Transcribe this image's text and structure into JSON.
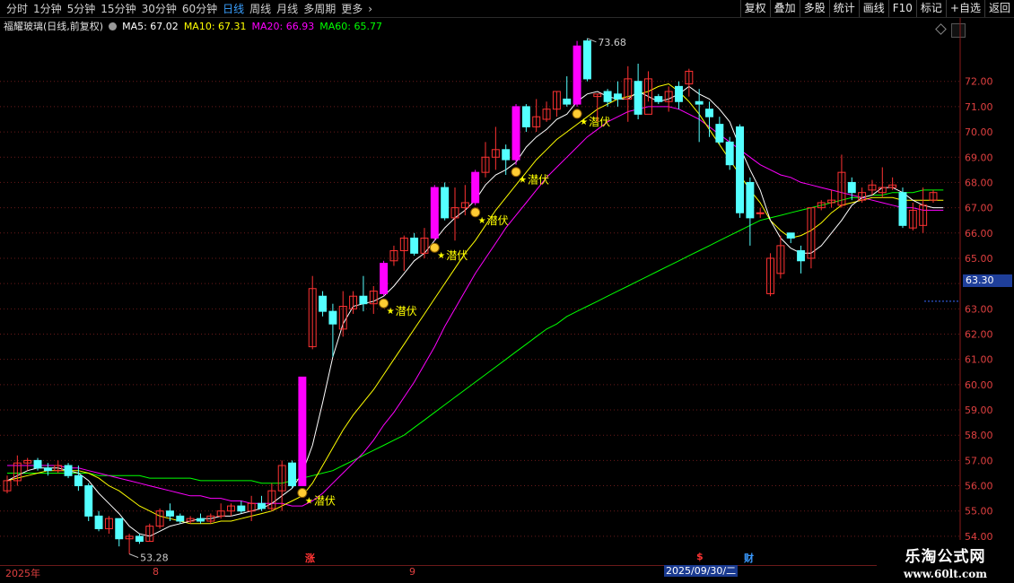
{
  "toolbar": {
    "periods": [
      "分时",
      "1分钟",
      "5分钟",
      "15分钟",
      "30分钟",
      "60分钟",
      "日线",
      "周线",
      "月线",
      "多周期",
      "更多"
    ],
    "active_period": "日线",
    "right_buttons": [
      "复权",
      "叠加",
      "多股",
      "统计",
      "画线",
      "F10",
      "标记",
      "+自选",
      "返回"
    ]
  },
  "info": {
    "title": "福耀玻璃(日线,前复权)",
    "ma5": "MA5: 67.02",
    "ma10": "MA10: 67.31",
    "ma20": "MA20: 66.93",
    "ma60": "MA60: 65.77"
  },
  "colors": {
    "up": "#ff3232",
    "down": "#54ffff",
    "ma5": "#ffffff",
    "ma10": "#ffff00",
    "ma20": "#ff00ff",
    "ma60": "#00ff00",
    "signal_candle": "#ff00ff",
    "signal_text": "#ffff00",
    "grid": "#6a1a1a",
    "axis_text": "#e04040"
  },
  "y_axis": {
    "ticks": [
      "72.00",
      "71.00",
      "70.00",
      "69.00",
      "68.00",
      "67.00",
      "66.00",
      "65.00",
      "64.00",
      "63.00",
      "62.00",
      "61.00",
      "60.00",
      "59.00",
      "58.00",
      "57.00",
      "56.00",
      "55.00",
      "54.00"
    ],
    "current_price": "63.30"
  },
  "annotations": {
    "high": "73.68",
    "low": "53.28",
    "signal_label": "潜伏"
  },
  "date_bar": {
    "year": "2025年",
    "month_8": "8",
    "month_9": "9",
    "selected_date": "2025/09/30/二"
  },
  "events": {
    "zhang": "涨",
    "dollar": "$",
    "cai": "财"
  },
  "watermark": {
    "title": "乐淘公式网",
    "url": "www.60lt.com"
  },
  "chart_data": {
    "type": "candlestick",
    "candles": [
      {
        "o": 55.8,
        "h": 56.4,
        "l": 55.7,
        "c": 56.2
      },
      {
        "o": 56.2,
        "h": 57.2,
        "l": 56.0,
        "c": 56.9
      },
      {
        "o": 56.9,
        "h": 57.1,
        "l": 56.6,
        "c": 57.0
      },
      {
        "o": 57.0,
        "h": 57.1,
        "l": 56.6,
        "c": 56.7
      },
      {
        "o": 56.7,
        "h": 56.9,
        "l": 56.4,
        "c": 56.6
      },
      {
        "o": 56.6,
        "h": 57.0,
        "l": 56.5,
        "c": 56.8
      },
      {
        "o": 56.8,
        "h": 56.9,
        "l": 56.3,
        "c": 56.4
      },
      {
        "o": 56.4,
        "h": 56.8,
        "l": 55.8,
        "c": 56.0
      },
      {
        "o": 56.0,
        "h": 56.1,
        "l": 54.6,
        "c": 54.8
      },
      {
        "o": 54.8,
        "h": 55.0,
        "l": 54.2,
        "c": 54.3
      },
      {
        "o": 54.3,
        "h": 54.8,
        "l": 54.1,
        "c": 54.7
      },
      {
        "o": 54.7,
        "h": 54.7,
        "l": 53.6,
        "c": 53.9
      },
      {
        "o": 53.9,
        "h": 54.1,
        "l": 53.3,
        "c": 54.0
      },
      {
        "o": 54.0,
        "h": 54.1,
        "l": 53.7,
        "c": 53.8
      },
      {
        "o": 53.8,
        "h": 54.5,
        "l": 53.8,
        "c": 54.4
      },
      {
        "o": 54.4,
        "h": 55.1,
        "l": 54.3,
        "c": 55.0
      },
      {
        "o": 55.0,
        "h": 55.3,
        "l": 54.6,
        "c": 54.8
      },
      {
        "o": 54.8,
        "h": 54.9,
        "l": 54.5,
        "c": 54.6
      },
      {
        "o": 54.6,
        "h": 54.8,
        "l": 54.5,
        "c": 54.7
      },
      {
        "o": 54.7,
        "h": 54.9,
        "l": 54.5,
        "c": 54.6
      },
      {
        "o": 54.6,
        "h": 54.9,
        "l": 54.5,
        "c": 54.8
      },
      {
        "o": 54.8,
        "h": 55.3,
        "l": 54.7,
        "c": 55.0
      },
      {
        "o": 55.0,
        "h": 55.3,
        "l": 54.8,
        "c": 55.2
      },
      {
        "o": 55.2,
        "h": 55.4,
        "l": 54.9,
        "c": 55.0
      },
      {
        "o": 55.0,
        "h": 55.6,
        "l": 54.6,
        "c": 55.3
      },
      {
        "o": 55.3,
        "h": 55.6,
        "l": 55.0,
        "c": 55.1
      },
      {
        "o": 55.1,
        "h": 56.1,
        "l": 55.0,
        "c": 55.8
      },
      {
        "o": 55.8,
        "h": 57.0,
        "l": 55.0,
        "c": 56.8
      },
      {
        "o": 56.9,
        "h": 57.0,
        "l": 55.9,
        "c": 56.0
      },
      {
        "o": 56.0,
        "h": 56.7,
        "l": 56.0,
        "c": 60.3,
        "signal": true
      },
      {
        "o": 61.5,
        "h": 64.3,
        "l": 61.4,
        "c": 63.8
      },
      {
        "o": 63.5,
        "h": 63.7,
        "l": 62.7,
        "c": 62.9
      },
      {
        "o": 62.9,
        "h": 63.2,
        "l": 61.1,
        "c": 62.4
      },
      {
        "o": 62.2,
        "h": 63.7,
        "l": 61.9,
        "c": 63.1
      },
      {
        "o": 63.0,
        "h": 63.7,
        "l": 62.8,
        "c": 63.5
      },
      {
        "o": 63.5,
        "h": 64.3,
        "l": 62.9,
        "c": 63.2
      },
      {
        "o": 63.2,
        "h": 63.9,
        "l": 62.8,
        "c": 63.7
      },
      {
        "o": 63.6,
        "h": 64.9,
        "l": 63.5,
        "c": 64.8,
        "signal": true
      },
      {
        "o": 64.9,
        "h": 65.5,
        "l": 64.7,
        "c": 65.3
      },
      {
        "o": 65.3,
        "h": 65.9,
        "l": 64.5,
        "c": 65.8
      },
      {
        "o": 65.8,
        "h": 66.0,
        "l": 65.1,
        "c": 65.2
      },
      {
        "o": 65.2,
        "h": 66.2,
        "l": 65.0,
        "c": 65.8
      },
      {
        "o": 65.8,
        "h": 67.9,
        "l": 65.7,
        "c": 67.8,
        "signal": true
      },
      {
        "o": 67.8,
        "h": 68.0,
        "l": 66.5,
        "c": 66.6
      },
      {
        "o": 66.6,
        "h": 67.8,
        "l": 65.7,
        "c": 67.0
      },
      {
        "o": 67.0,
        "h": 67.9,
        "l": 66.7,
        "c": 67.2
      },
      {
        "o": 67.2,
        "h": 68.5,
        "l": 67.1,
        "c": 68.4,
        "signal": true
      },
      {
        "o": 68.4,
        "h": 69.6,
        "l": 68.2,
        "c": 69.0
      },
      {
        "o": 69.0,
        "h": 70.2,
        "l": 68.5,
        "c": 69.3
      },
      {
        "o": 69.3,
        "h": 69.5,
        "l": 68.3,
        "c": 68.9
      },
      {
        "o": 68.9,
        "h": 71.1,
        "l": 68.7,
        "c": 71.0,
        "signal": true
      },
      {
        "o": 71.0,
        "h": 71.1,
        "l": 70.0,
        "c": 70.2
      },
      {
        "o": 70.2,
        "h": 71.3,
        "l": 70.0,
        "c": 70.6
      },
      {
        "o": 70.5,
        "h": 71.2,
        "l": 70.4,
        "c": 70.9
      },
      {
        "o": 70.9,
        "h": 71.6,
        "l": 70.6,
        "c": 71.6
      },
      {
        "o": 71.3,
        "h": 72.2,
        "l": 71.0,
        "c": 71.1
      },
      {
        "o": 71.1,
        "h": 73.6,
        "l": 71.0,
        "c": 73.4,
        "signal": true
      },
      {
        "o": 73.6,
        "h": 73.7,
        "l": 72.0,
        "c": 72.1
      },
      {
        "o": 71.4,
        "h": 71.5,
        "l": 70.4,
        "c": 71.5
      },
      {
        "o": 71.6,
        "h": 71.7,
        "l": 71.0,
        "c": 71.2
      },
      {
        "o": 71.5,
        "h": 72.0,
        "l": 71.0,
        "c": 71.3
      },
      {
        "o": 71.3,
        "h": 72.6,
        "l": 70.4,
        "c": 72.1
      },
      {
        "o": 72.0,
        "h": 72.7,
        "l": 70.5,
        "c": 70.7
      },
      {
        "o": 70.7,
        "h": 72.4,
        "l": 71.2,
        "c": 72.1
      },
      {
        "o": 71.4,
        "h": 71.5,
        "l": 71.1,
        "c": 71.2
      },
      {
        "o": 71.2,
        "h": 71.8,
        "l": 70.8,
        "c": 71.6
      },
      {
        "o": 71.8,
        "h": 72.0,
        "l": 70.9,
        "c": 71.2
      },
      {
        "o": 71.9,
        "h": 72.5,
        "l": 71.4,
        "c": 72.4
      },
      {
        "o": 71.2,
        "h": 71.7,
        "l": 69.6,
        "c": 71.1
      },
      {
        "o": 70.9,
        "h": 71.2,
        "l": 69.8,
        "c": 70.6
      },
      {
        "o": 70.3,
        "h": 70.6,
        "l": 69.5,
        "c": 69.6
      },
      {
        "o": 69.6,
        "h": 69.8,
        "l": 68.5,
        "c": 68.7
      },
      {
        "o": 70.2,
        "h": 70.3,
        "l": 66.6,
        "c": 66.8
      },
      {
        "o": 68.0,
        "h": 68.2,
        "l": 65.5,
        "c": 66.6
      },
      {
        "o": 66.8,
        "h": 67.0,
        "l": 66.6,
        "c": 66.8
      },
      {
        "o": 63.6,
        "h": 65.2,
        "l": 63.5,
        "c": 65.0
      },
      {
        "o": 64.4,
        "h": 65.9,
        "l": 64.2,
        "c": 65.5
      },
      {
        "o": 66.0,
        "h": 66.0,
        "l": 65.6,
        "c": 65.8
      },
      {
        "o": 65.3,
        "h": 65.5,
        "l": 64.4,
        "c": 64.9
      },
      {
        "o": 65.0,
        "h": 67.0,
        "l": 64.6,
        "c": 67.0
      },
      {
        "o": 67.0,
        "h": 67.3,
        "l": 66.9,
        "c": 67.2
      },
      {
        "o": 67.2,
        "h": 67.7,
        "l": 67.0,
        "c": 67.3
      },
      {
        "o": 67.1,
        "h": 69.1,
        "l": 67.0,
        "c": 68.4
      },
      {
        "o": 68.0,
        "h": 68.2,
        "l": 67.3,
        "c": 67.6
      },
      {
        "o": 67.3,
        "h": 67.8,
        "l": 67.2,
        "c": 67.6
      },
      {
        "o": 67.7,
        "h": 68.1,
        "l": 67.5,
        "c": 67.9
      },
      {
        "o": 67.6,
        "h": 68.6,
        "l": 67.4,
        "c": 67.8
      },
      {
        "o": 67.8,
        "h": 68.2,
        "l": 67.7,
        "c": 67.9
      },
      {
        "o": 67.6,
        "h": 67.8,
        "l": 66.2,
        "c": 66.3
      },
      {
        "o": 66.2,
        "h": 67.2,
        "l": 66.1,
        "c": 66.9
      },
      {
        "o": 66.3,
        "h": 67.8,
        "l": 66.0,
        "c": 67.1
      },
      {
        "o": 67.3,
        "h": 67.7,
        "l": 67.2,
        "c": 67.6
      }
    ],
    "ma5": [
      56.2,
      56.4,
      56.6,
      56.7,
      56.7,
      56.7,
      56.6,
      56.5,
      56.2,
      55.7,
      55.3,
      54.9,
      54.4,
      54.1,
      54.0,
      54.2,
      54.4,
      54.5,
      54.6,
      54.7,
      54.7,
      54.8,
      54.8,
      54.9,
      55.0,
      55.1,
      55.3,
      55.6,
      55.9,
      56.5,
      57.6,
      59.3,
      61.1,
      62.4,
      63.1,
      63.2,
      63.3,
      63.5,
      63.9,
      64.4,
      64.9,
      65.2,
      65.7,
      66.2,
      66.6,
      66.9,
      67.3,
      67.9,
      68.3,
      68.5,
      68.8,
      69.4,
      69.8,
      70.1,
      70.5,
      70.7,
      71.2,
      71.5,
      71.6,
      71.4,
      71.3,
      71.3,
      71.6,
      71.4,
      71.2,
      71.3,
      71.5,
      71.8,
      71.5,
      71.3,
      70.9,
      70.4,
      69.4,
      68.5,
      67.7,
      66.5,
      65.8,
      65.4,
      65.2,
      65.2,
      65.5,
      66.0,
      66.5,
      67.1,
      67.4,
      67.5,
      67.8,
      67.8,
      67.6,
      67.3,
      67.1,
      67.0,
      67.0
    ],
    "ma10": [
      56.2,
      56.3,
      56.4,
      56.5,
      56.6,
      56.6,
      56.6,
      56.6,
      56.5,
      56.3,
      56.0,
      55.8,
      55.5,
      55.2,
      55.0,
      54.8,
      54.7,
      54.6,
      54.5,
      54.5,
      54.5,
      54.6,
      54.6,
      54.7,
      54.8,
      54.9,
      55.0,
      55.2,
      55.4,
      55.6,
      56.1,
      56.8,
      57.5,
      58.2,
      58.8,
      59.3,
      59.8,
      60.4,
      61.0,
      61.6,
      62.2,
      62.8,
      63.4,
      64.0,
      64.6,
      65.2,
      65.7,
      66.3,
      66.9,
      67.4,
      67.9,
      68.4,
      68.9,
      69.3,
      69.7,
      70.0,
      70.3,
      70.6,
      70.9,
      71.1,
      71.3,
      71.4,
      71.5,
      71.6,
      71.8,
      71.9,
      71.6,
      71.2,
      70.7,
      70.1,
      69.5,
      68.9,
      68.3,
      67.7,
      67.2,
      66.5,
      66.1,
      65.8,
      65.9,
      66.1,
      66.4,
      66.8,
      67.1,
      67.2,
      67.3,
      67.4,
      67.4,
      67.4,
      67.3,
      67.3,
      67.3,
      67.3,
      67.3
    ],
    "ma20": [
      56.8,
      56.8,
      56.8,
      56.8,
      56.8,
      56.8,
      56.7,
      56.7,
      56.6,
      56.5,
      56.4,
      56.3,
      56.2,
      56.1,
      56.0,
      55.9,
      55.8,
      55.7,
      55.6,
      55.6,
      55.5,
      55.5,
      55.4,
      55.4,
      55.3,
      55.3,
      55.3,
      55.3,
      55.2,
      55.2,
      55.4,
      55.7,
      56.1,
      56.5,
      56.9,
      57.3,
      57.8,
      58.4,
      58.9,
      59.5,
      60.1,
      60.8,
      61.5,
      62.3,
      63.0,
      63.7,
      64.4,
      65.0,
      65.6,
      66.2,
      66.7,
      67.2,
      67.7,
      68.2,
      68.6,
      69.0,
      69.4,
      69.8,
      70.1,
      70.4,
      70.6,
      70.8,
      70.9,
      71.0,
      71.0,
      71.0,
      70.9,
      70.7,
      70.5,
      70.2,
      69.9,
      69.6,
      69.3,
      69.0,
      68.7,
      68.5,
      68.3,
      68.2,
      68.0,
      67.9,
      67.8,
      67.7,
      67.6,
      67.5,
      67.4,
      67.3,
      67.2,
      67.1,
      67.0,
      67.0,
      66.9,
      66.9,
      66.9
    ],
    "ma60": [
      56.5,
      56.5,
      56.5,
      56.5,
      56.5,
      56.5,
      56.5,
      56.5,
      56.5,
      56.4,
      56.4,
      56.4,
      56.4,
      56.4,
      56.3,
      56.3,
      56.3,
      56.3,
      56.3,
      56.2,
      56.2,
      56.2,
      56.2,
      56.2,
      56.2,
      56.1,
      56.1,
      56.1,
      56.2,
      56.3,
      56.4,
      56.5,
      56.6,
      56.8,
      57.0,
      57.2,
      57.4,
      57.6,
      57.8,
      58.0,
      58.3,
      58.6,
      58.9,
      59.2,
      59.5,
      59.8,
      60.1,
      60.4,
      60.7,
      61.0,
      61.3,
      61.6,
      61.9,
      62.2,
      62.4,
      62.7,
      62.9,
      63.1,
      63.3,
      63.5,
      63.7,
      63.9,
      64.1,
      64.3,
      64.5,
      64.7,
      64.9,
      65.1,
      65.3,
      65.5,
      65.7,
      65.9,
      66.1,
      66.3,
      66.5,
      66.6,
      66.7,
      66.8,
      66.9,
      67.0,
      67.1,
      67.2,
      67.3,
      67.4,
      67.4,
      67.5,
      67.5,
      67.6,
      67.6,
      67.6,
      67.7,
      67.7,
      67.7
    ],
    "ylim": [
      53.5,
      73.8
    ]
  }
}
